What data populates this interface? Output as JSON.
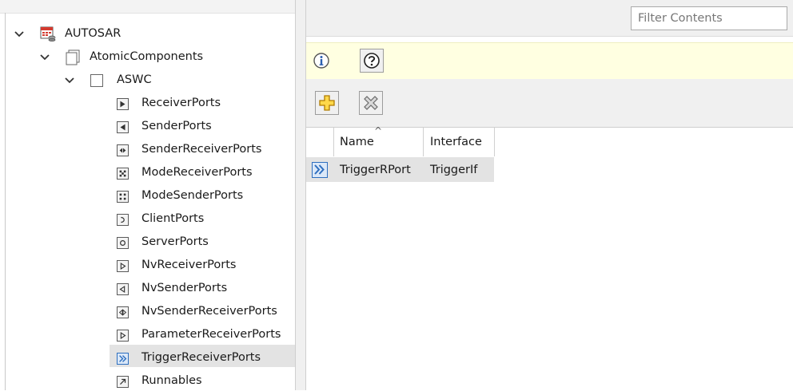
{
  "tree": {
    "root": {
      "label": "AUTOSAR",
      "icon": "autosar-database-icon"
    },
    "atomic": {
      "label": "AtomicComponents",
      "icon": "folder-page-icon"
    },
    "component": {
      "label": "ASWC",
      "icon": "component-box-icon"
    },
    "items": [
      {
        "label": "ReceiverPorts",
        "icon": "receiver-port-icon"
      },
      {
        "label": "SenderPorts",
        "icon": "sender-port-icon"
      },
      {
        "label": "SenderReceiverPorts",
        "icon": "sender-receiver-port-icon"
      },
      {
        "label": "ModeReceiverPorts",
        "icon": "mode-receiver-port-icon"
      },
      {
        "label": "ModeSenderPorts",
        "icon": "mode-sender-port-icon"
      },
      {
        "label": "ClientPorts",
        "icon": "client-port-icon"
      },
      {
        "label": "ServerPorts",
        "icon": "server-port-icon"
      },
      {
        "label": "NvReceiverPorts",
        "icon": "nv-receiver-port-icon"
      },
      {
        "label": "NvSenderPorts",
        "icon": "nv-sender-port-icon"
      },
      {
        "label": "NvSenderReceiverPorts",
        "icon": "nv-sender-receiver-port-icon"
      },
      {
        "label": "ParameterReceiverPorts",
        "icon": "parameter-receiver-port-icon"
      },
      {
        "label": "TriggerReceiverPorts",
        "icon": "trigger-port-icon",
        "selected": true
      },
      {
        "label": "Runnables",
        "icon": "runnable-arrow-icon"
      }
    ]
  },
  "filter": {
    "placeholder": "Filter Contents",
    "value": ""
  },
  "infobar": {
    "info_icon": "info-icon",
    "help_icon": "help-question-icon"
  },
  "toolbar": {
    "add_icon": "add-plus-icon",
    "delete_icon": "delete-x-icon"
  },
  "table": {
    "columns": [
      "Name",
      "Interface"
    ],
    "sort_indicator": "^",
    "rows": [
      {
        "name": "TriggerRPort",
        "interface": "TriggerIf",
        "icon": "trigger-port-icon"
      }
    ]
  },
  "colors": {
    "info_bar": "#ffffe1",
    "selection": "#e3e3e3",
    "trigger_icon": "#2e6fbf"
  }
}
